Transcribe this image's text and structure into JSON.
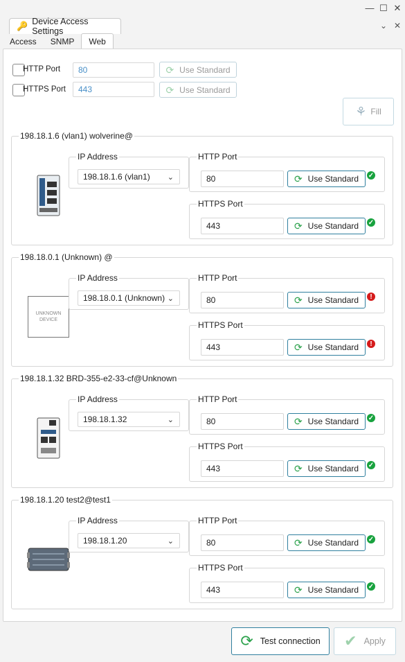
{
  "window": {
    "tab_title": "Device Access Settings",
    "controls": [
      "minimize-icon",
      "maximize-icon",
      "close-icon"
    ]
  },
  "tabs": [
    {
      "label": "Access",
      "active": false
    },
    {
      "label": "SNMP",
      "active": false
    },
    {
      "label": "Web",
      "active": true
    }
  ],
  "global": {
    "http": {
      "label": "HTTP Port",
      "value": "80",
      "button": "Use Standard"
    },
    "https": {
      "label": "HTTPS Port",
      "value": "443",
      "button": "Use Standard"
    },
    "fill_label": "Fill"
  },
  "devices": [
    {
      "title": "198.18.1.6 (vlan1) wolverine@",
      "ip_label": "IP Address",
      "ip_value": "198.18.1.6 (vlan1)",
      "http_label": "HTTP Port",
      "http_value": "80",
      "http_button": "Use Standard",
      "http_status": "ok",
      "https_label": "HTTPS Port",
      "https_value": "443",
      "https_button": "Use Standard",
      "https_status": "ok",
      "image": "din-rail-switch"
    },
    {
      "title": "198.18.0.1 (Unknown) @",
      "ip_label": "IP Address",
      "ip_value": "198.18.0.1 (Unknown)",
      "http_label": "HTTP Port",
      "http_value": "80",
      "http_button": "Use Standard",
      "http_status": "error",
      "https_label": "HTTPS Port",
      "https_value": "443",
      "https_button": "Use Standard",
      "https_status": "error",
      "image": "unknown-device",
      "image_text": "UNKNOWN DEVICE"
    },
    {
      "title": "198.18.1.32 BRD-355-e2-33-cf@Unknown",
      "ip_label": "IP Address",
      "ip_value": "198.18.1.32",
      "http_label": "HTTP Port",
      "http_value": "80",
      "http_button": "Use Standard",
      "http_status": "ok",
      "https_label": "HTTPS Port",
      "https_value": "443",
      "https_button": "Use Standard",
      "https_status": "ok",
      "image": "din-rail-router"
    },
    {
      "title": "198.18.1.20 test2@test1",
      "ip_label": "IP Address",
      "ip_value": "198.18.1.20",
      "http_label": "HTTP Port",
      "http_value": "80",
      "http_button": "Use Standard",
      "http_status": "ok",
      "https_label": "HTTPS Port",
      "https_value": "443",
      "https_button": "Use Standard",
      "https_status": "ok",
      "image": "rugged-router"
    }
  ],
  "footer": {
    "test_label": "Test connection",
    "apply_label": "Apply"
  }
}
